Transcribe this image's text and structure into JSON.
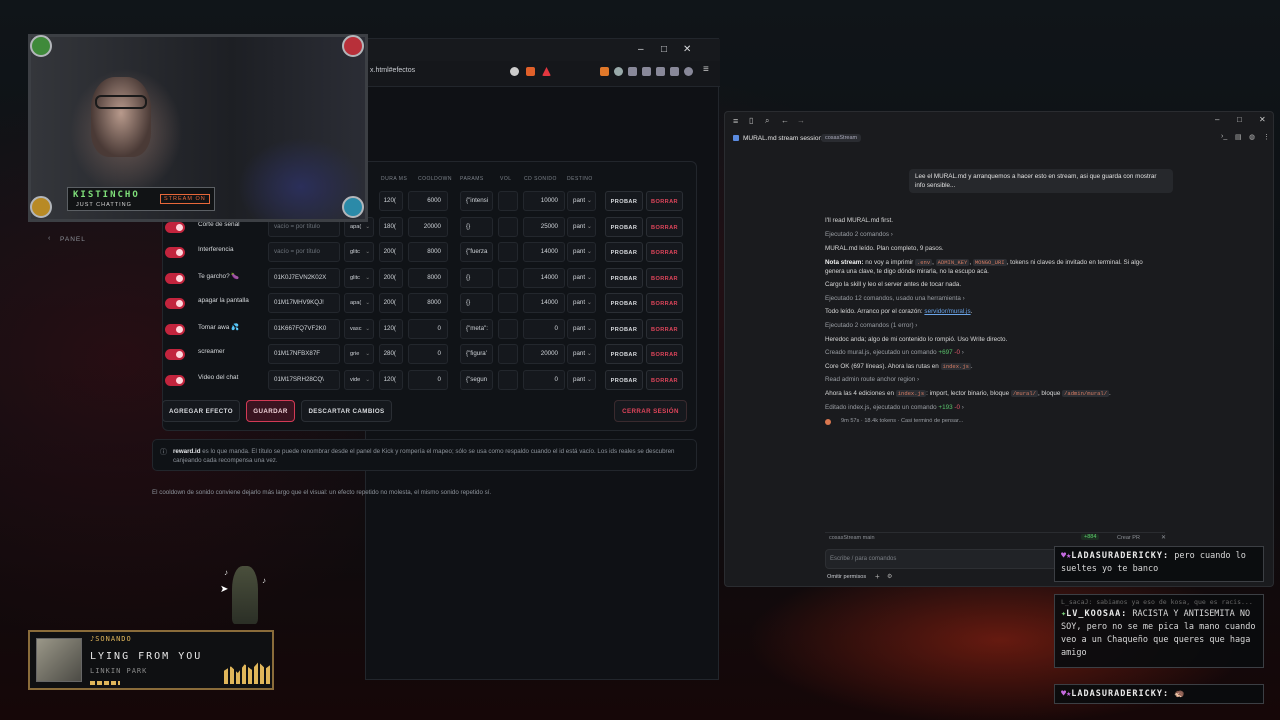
{
  "browser": {
    "url": "x.html#efectos",
    "controls": {
      "minimize": "–",
      "maximize": "□",
      "close": "✕"
    }
  },
  "app": {
    "panel_label": "PANEL",
    "columns": [
      "DURA MS",
      "COOLDOWN",
      "PARAMS",
      "VOL",
      "CD SONIDO",
      "DESTINO"
    ],
    "rows": [
      {
        "name": "",
        "title": "",
        "type": "",
        "dura": "120(",
        "cooldown": "6000",
        "params": "{\"intensi",
        "cd": "10000",
        "destino": "pant"
      },
      {
        "name": "Corte de senal",
        "title": "vacío = por título",
        "title_is_placeholder": true,
        "type": "apa(",
        "dura": "180(",
        "cooldown": "20000",
        "params": "{}",
        "cd": "25000",
        "destino": "pant"
      },
      {
        "name": "Interferencia",
        "title": "vacío = por título",
        "title_is_placeholder": true,
        "type": "glitc",
        "dura": "200(",
        "cooldown": "8000",
        "params": "{\"fuerza",
        "cd": "14000",
        "destino": "pant"
      },
      {
        "name": "Te garcho? 🍆",
        "title": "01K0J7EVN2K02X",
        "title_is_placeholder": false,
        "type": "glitc",
        "dura": "200(",
        "cooldown": "8000",
        "params": "{}",
        "cd": "14000",
        "destino": "pant"
      },
      {
        "name": "apagar la pantalla",
        "title": "01M17MHV9KQJ!",
        "title_is_placeholder": false,
        "type": "apa(",
        "dura": "200(",
        "cooldown": "8000",
        "params": "{}",
        "cd": "14000",
        "destino": "pant"
      },
      {
        "name": "Tomar awa 💦",
        "title": "01K667FQ7VF2K0",
        "title_is_placeholder": false,
        "type": "vasc",
        "dura": "120(",
        "cooldown": "0",
        "params": "{\"meta\":",
        "cd": "0",
        "destino": "pant"
      },
      {
        "name": "screamer",
        "title": "01M17NFBX87F",
        "title_is_placeholder": false,
        "type": "grie",
        "dura": "280(",
        "cooldown": "0",
        "params": "{\"figura'",
        "cd": "20000",
        "destino": "pant"
      },
      {
        "name": "Video del chat",
        "title": "01M17SRH28CQ\\",
        "title_is_placeholder": false,
        "type": "vide",
        "dura": "120(",
        "cooldown": "0",
        "params": "{\"segun",
        "cd": "0",
        "destino": "pant"
      }
    ],
    "probar": "PROBAR",
    "borrar": "BORRAR",
    "footer": {
      "add": "AGREGAR EFECTO",
      "save": "GUARDAR",
      "discard": "DESCARTAR CAMBIOS",
      "logout": "CERRAR SESIÓN"
    },
    "note_bold": "reward.id",
    "note": " es lo que manda. El título se puede renombrar desde el panel de Kick y rompería el mapeo; sólo se usa como respaldo cuando el id está vacío. Los ids reales se descubren canjeando cada recompensa una vez.",
    "cooldown_note": "El cooldown de sonido conviene dejarlo más largo que el visual: un efecto repetido no molesta, el mismo sonido repetido sí."
  },
  "webcam": {
    "name": "KISTINCHO",
    "category": "JUST CHATTING",
    "status": "STREAM ON"
  },
  "claude": {
    "title": "MURAL.md stream session",
    "tag": "cosasStream",
    "user_message": "Lee el MURAL.md y arranquemos a hacer esto en stream, asi que guarda con mostrar info sensible...",
    "lines": {
      "l1": "I'll read MURAL.md first.",
      "l2": "Ejecutado 2 comandos ›",
      "l3": "MURAL.md leído. Plan completo, 9 pasos.",
      "l4a": "Nota stream:",
      "l4b": " no voy a imprimir ",
      "l4c1": ".env",
      "l4c2": "ADMIN_KEY",
      "l4c3": "MONGO_URI",
      "l4d": ", tokens ni claves de invitado en terminal. Si algo",
      "l4e": "genera una clave, te digo dónde mirarla, no la escupo acá.",
      "l5": "Cargo la skill y leo el server antes de tocar nada.",
      "l6": "Ejecutado 12 comandos, usado una herramienta ›",
      "l7a": "Todo leído. Arranco por el corazón: ",
      "l7b": "servidor/mural.js",
      "l8": "Ejecutado 2 comandos (1 error) ›",
      "l9": "Heredoc anda; algo de mi contenido lo rompió. Uso Write directo.",
      "l10a": "Creado mural.js, ejecutado un comando ",
      "l10b": "+697",
      "l10c": "-0",
      "l11a": "Core OK (697 líneas). Ahora las rutas en ",
      "l11b": "index.js",
      "l12": "Read admin route anchor region ›",
      "l13a": "Ahora las 4 ediciones en ",
      "l13b": "index.js",
      "l13c": ": import, lector binario, bloque ",
      "l13d": "/mural/",
      "l13e": ", bloque ",
      "l13f": "/admin/mural/",
      "l14a": "Editado index.js, ejecutado un comando ",
      "l14b": "+193",
      "l14c": "-0",
      "l15": "9m 57s · 18.4k tokens · Casi terminó de pensar..."
    },
    "branch": "cosasStream  main",
    "diff": "+884",
    "create_pr": "Crear PR",
    "input_placeholder": "Escribe / para comandos",
    "permissions": "Omitir permisos"
  },
  "chat": [
    {
      "user": "LADASURADERICKY:",
      "text": " pero cuando lo sueltes yo te banco"
    },
    {
      "user": "",
      "text": "L_sacaJ: sabiamos ya eso de kosa, que es racis..."
    },
    {
      "user": "LV_KOOSAA:",
      "text": " RACISTA Y ANTISEMITA NO SOY, pero no se me pica la mano cuando veo a un Chaqueño que queres que haga amigo"
    },
    {
      "user": "LADASURADERICKY:",
      "text": " 🦔"
    }
  ],
  "now_playing": {
    "label": "SONANDO",
    "song": "LYING FROM YOU",
    "artist": "LINKIN PARK"
  }
}
